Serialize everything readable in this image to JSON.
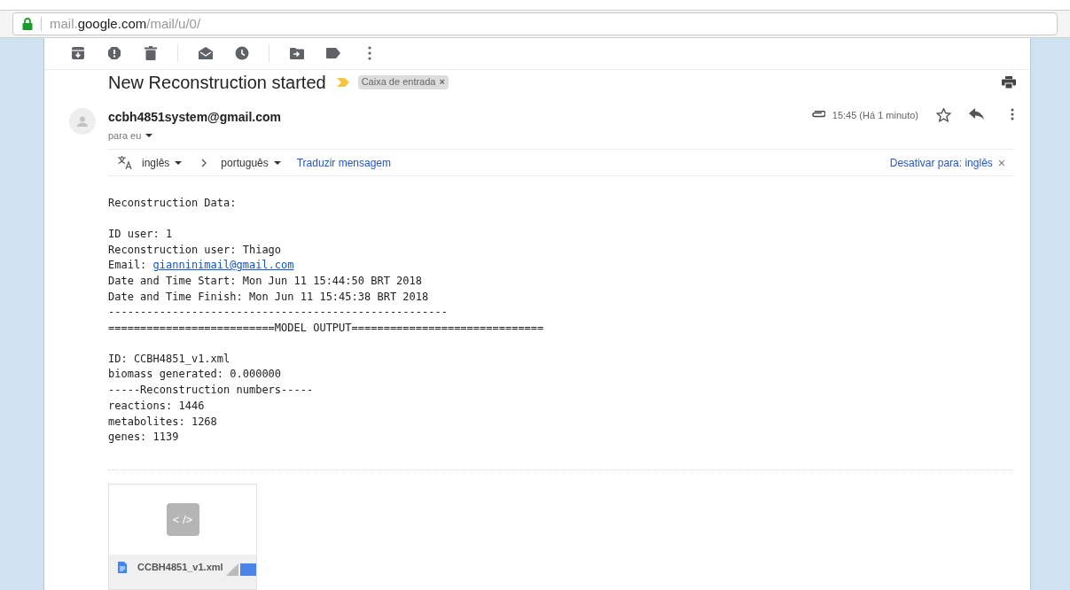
{
  "address_bar": {
    "host_prefix": "mail.",
    "host": "google.com",
    "path": "/mail/u/0/"
  },
  "subject": {
    "title": "New Reconstruction started",
    "label": "Caixa de entrada",
    "label_remove": "×"
  },
  "message": {
    "sender": "ccbh4851system@gmail.com",
    "recipient": "para eu",
    "time": "15:45 (Há 1 minuto)",
    "starred": false
  },
  "translate_bar": {
    "from": "inglês",
    "to": "português",
    "action": "Traduzir mensagem",
    "disable": "Desativar para: inglês",
    "close": "×"
  },
  "body": [
    [
      {
        "kind": "text",
        "text": "Reconstruction Data:"
      }
    ],
    [
      {
        "kind": "text",
        "text": "ID user: 1"
      },
      {
        "kind": "text",
        "text": "Reconstruction user: Thiago"
      },
      {
        "kind": "link",
        "text": "Email:",
        "link": "gianninimail@gmail.com"
      },
      {
        "kind": "text",
        "text": "Date and Time Start: Mon Jun 11 15:44:50 BRT 2018"
      },
      {
        "kind": "text",
        "text": "Date and Time Finish: Mon Jun 11 15:45:38 BRT 2018"
      },
      {
        "kind": "text",
        "text": "-----------------------------------------------------"
      },
      {
        "kind": "text",
        "text": "==========================MODEL OUTPUT=============================="
      }
    ],
    [
      {
        "kind": "text",
        "text": "ID: CCBH4851_v1.xml"
      },
      {
        "kind": "text",
        "text": "biomass generated: 0.000000"
      },
      {
        "kind": "text",
        "text": "-----Reconstruction numbers-----"
      },
      {
        "kind": "text",
        "text": "reactions: 1446"
      },
      {
        "kind": "text",
        "text": "metabolites: 1268"
      },
      {
        "kind": "text",
        "text": "genes: 1139"
      }
    ]
  ],
  "attachment": {
    "preview": "< />",
    "filename": "CCBH4851_v1.xml"
  }
}
